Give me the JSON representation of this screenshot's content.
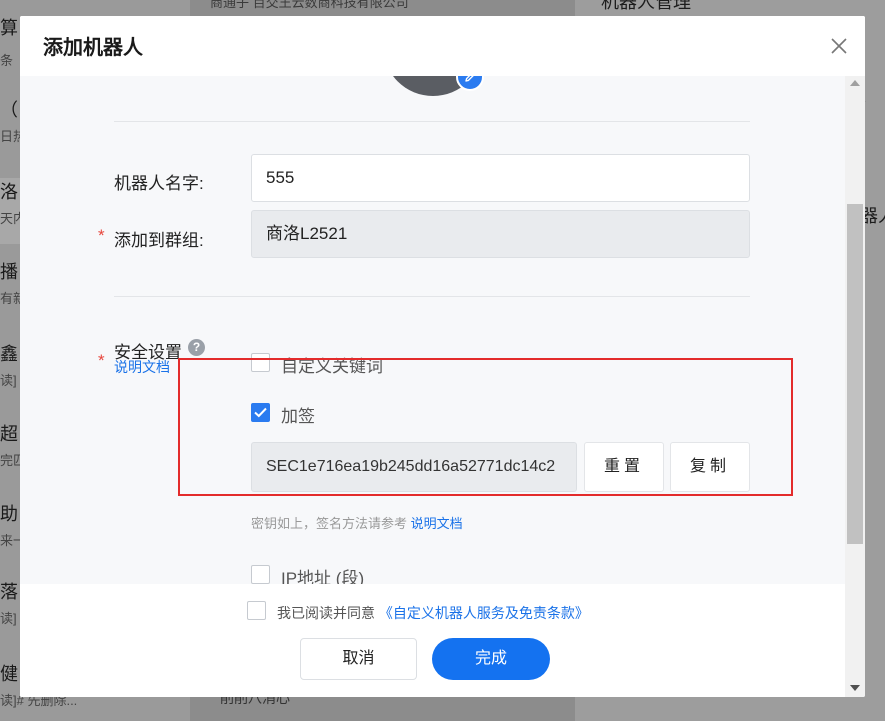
{
  "background": {
    "chat_items": [
      {
        "title": "算",
        "preview": "条"
      },
      {
        "title": "（",
        "preview": "日热"
      },
      {
        "title": "洛",
        "preview": "天内"
      },
      {
        "title": "播",
        "preview": "有新"
      },
      {
        "title": "鑫",
        "preview": "读]"
      },
      {
        "title": "超",
        "preview": "完匹"
      },
      {
        "title": "助",
        "preview": "来一"
      },
      {
        "title": "落",
        "preview": "读]"
      },
      {
        "title": "健",
        "preview": "读]# 先删除..."
      }
    ],
    "middle_top": "商通子  百交王云数商科技有限公司",
    "middle_bottom": "削削八消心",
    "right_title": "机器人管理",
    "right_items": [
      "人",
      "器人"
    ]
  },
  "modal": {
    "title": "添加机器人",
    "form": {
      "name_label": "机器人名字:",
      "name_value": "555",
      "group_label": "添加到群组:",
      "group_value": "商洛L2521",
      "security_label": "安全设置",
      "doc_link": "说明文档",
      "help_icon": "?",
      "required_mark": "*"
    },
    "security": {
      "keyword_label": "自定义关键词",
      "sign_label": "加签",
      "secret_value": "SEC1e716ea19b245dd16a52771dc14c2",
      "reset_label": "重置",
      "copy_label": "复制",
      "hint_text": "密钥如上，签名方法请参考",
      "hint_link": "说明文档",
      "ip_label": "IP地址 (段)"
    },
    "footer": {
      "agree_text": "我已阅读并同意",
      "agree_link": "《自定义机器人服务及免责条款》",
      "cancel_label": "取消",
      "ok_label": "完成"
    }
  },
  "colors": {
    "accent": "#1472f0",
    "highlight_box": "#e32b2b",
    "required": "#e7453b"
  }
}
